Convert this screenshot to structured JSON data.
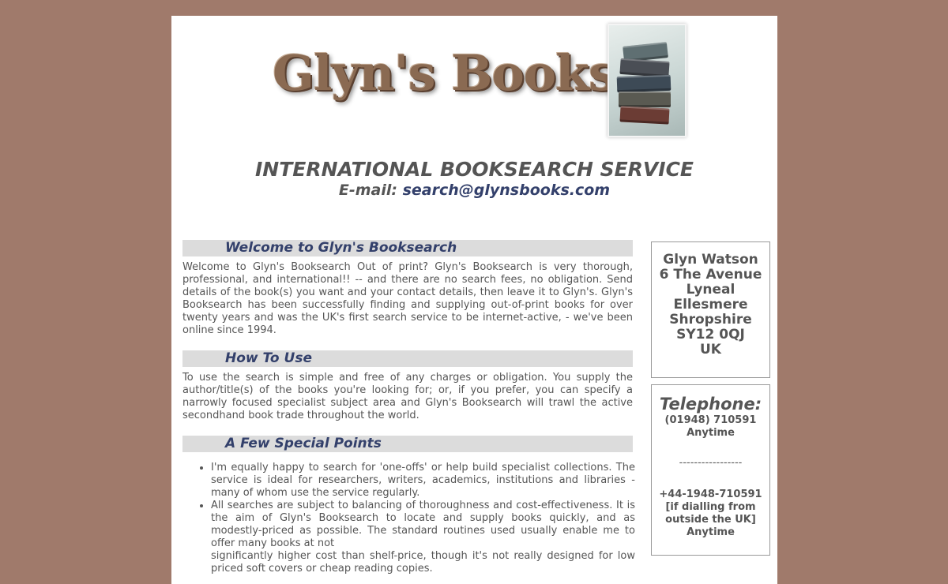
{
  "header": {
    "logo_text": "Glyn's Books",
    "headline": "INTERNATIONAL BOOKSEARCH SERVICE",
    "email_label": "E-mail: ",
    "email": "search@glynsbooks.com"
  },
  "sections": {
    "welcome": {
      "title": "Welcome to Glyn's Booksearch",
      "text": "Welcome to Glyn's Booksearch Out of print? Glyn's Booksearch is very thorough, professional, and international!! -- and there are no search fees, no obligation. Send details of the book(s) you want and your contact details, then leave it to Glyn's. Glyn's Booksearch has been successfully finding and supplying out-of-print books for over twenty years and was the UK's first search service to be internet-active, - we've been online since 1994."
    },
    "how_to_use": {
      "title": "How To Use",
      "text": "To use the search is simple and free of any charges or obligation. You supply the author/title(s) of the books you're looking for; or, if you prefer, you can specify a narrowly focused specialist subject area and Glyn's Booksearch will trawl the active secondhand book trade throughout the world."
    },
    "special_points": {
      "title": "A Few Special Points",
      "items": [
        "I'm equally happy to search for 'one-offs' or help build specialist collections. The service is ideal for researchers, writers, academics, institutions and libraries - many of whom use the service regularly.",
        "All searches are subject to balancing of thoroughness and cost-effectiveness. It is the aim of Glyn's Booksearch to locate and supply books quickly, and as modestly-priced as possible. The standard routines used usually enable me to offer many books at not",
        "significantly higher cost than shelf-price, though it's not really designed for low priced soft covers or cheap reading copies."
      ]
    }
  },
  "sidebar": {
    "address": [
      "Glyn Watson",
      "6 The Avenue",
      "Lyneal",
      "Ellesmere",
      "Shropshire",
      "SY12 0QJ",
      "UK"
    ],
    "telephone": {
      "title": "Telephone:",
      "uk_number": "(01948) 710591",
      "uk_hours": "Anytime",
      "separator": "-----------------",
      "intl_number": "+44-1948-710591",
      "intl_note_1": "[if dialling from",
      "intl_note_2": "outside the UK]",
      "intl_hours": "Anytime"
    }
  },
  "colors": {
    "background": "#a07a6b",
    "page": "#ffffff",
    "section_bar": "#dcdcdc",
    "accent": "#33406b",
    "text": "#555555"
  }
}
